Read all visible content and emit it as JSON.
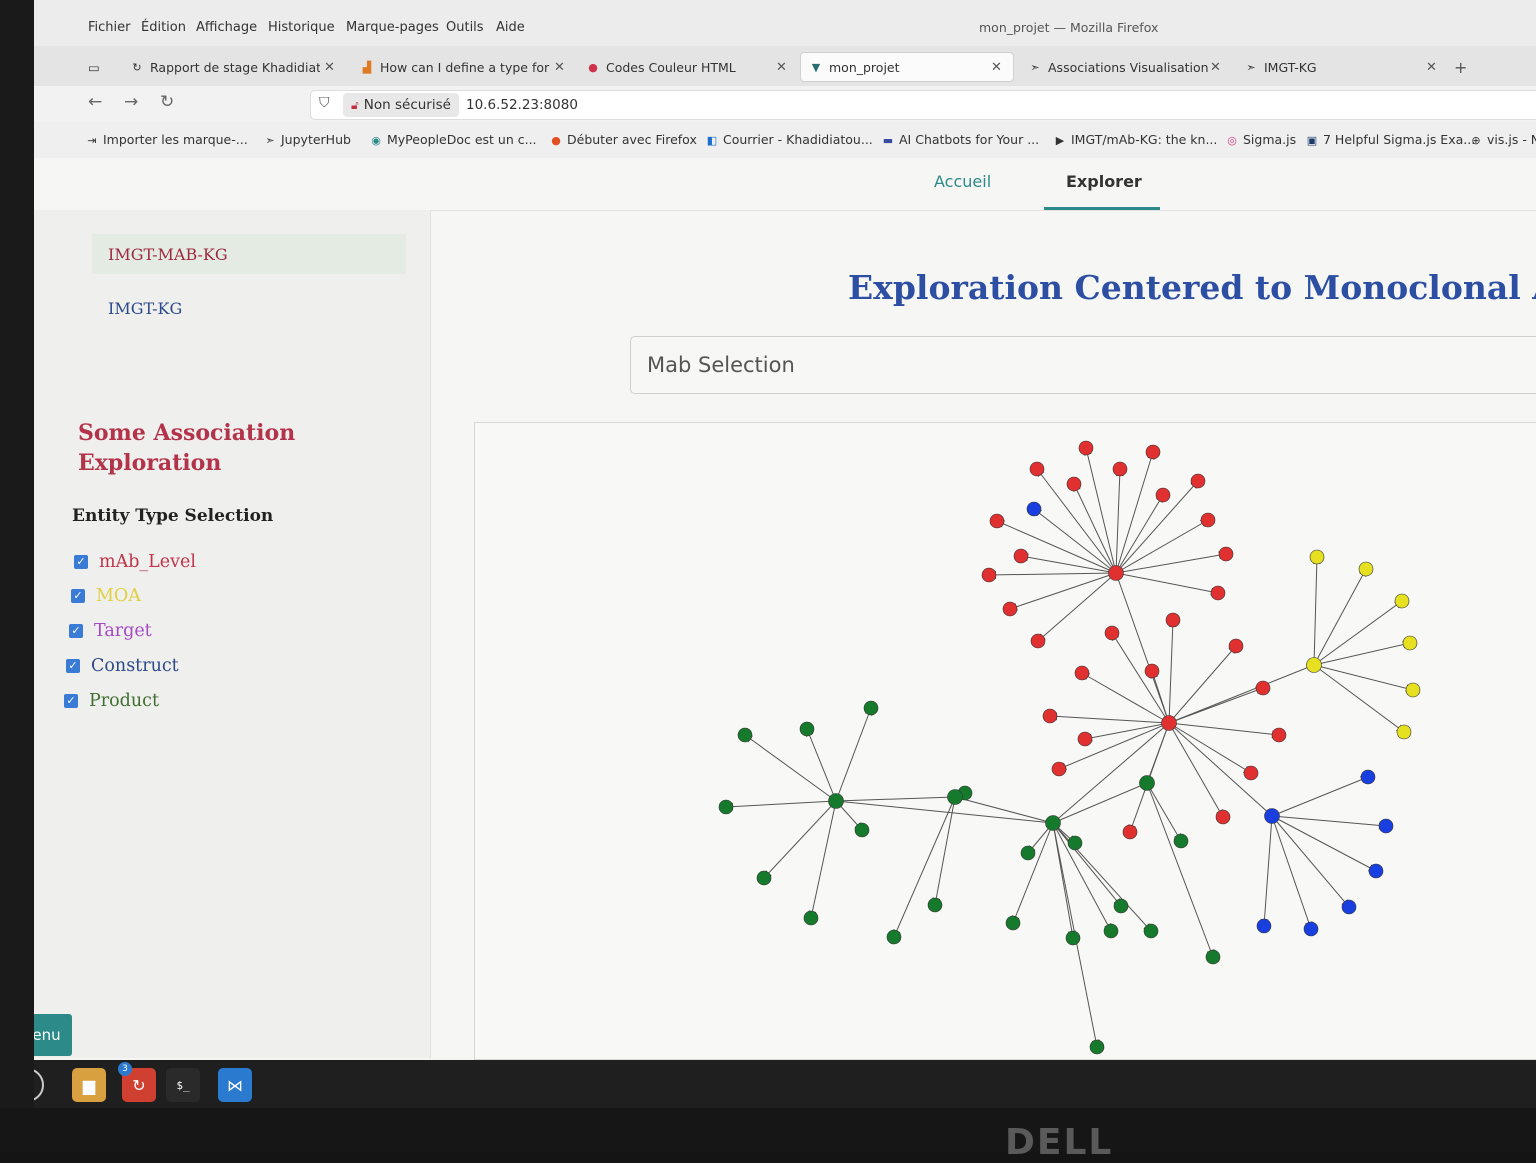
{
  "window_title": "mon_projet — Mozilla Firefox",
  "menu": [
    "Fichier",
    "Édition",
    "Affichage",
    "Historique",
    "Marque-pages",
    "Outils",
    "Aide"
  ],
  "tabs": [
    {
      "label": "Rapport de stage Khadidiato",
      "icon": "document-icon"
    },
    {
      "label": "How can I define a type for a",
      "icon": "stackoverflow-icon"
    },
    {
      "label": "Codes Couleur HTML",
      "icon": "color-icon"
    },
    {
      "label": "mon_projet",
      "icon": "vue-icon"
    },
    {
      "label": "Associations Visualisation",
      "icon": "jupyter-icon"
    },
    {
      "label": "IMGT-KG",
      "icon": "jupyter-icon"
    }
  ],
  "navbar": {
    "security_label": "Non sécurisé",
    "url": "10.6.52.23:8080"
  },
  "bookmarks": [
    {
      "label": "Importer les marque-...",
      "icon": "import-icon"
    },
    {
      "label": "JupyterHub",
      "icon": "jupyter-icon"
    },
    {
      "label": "MyPeopleDoc est un c...",
      "icon": "people-icon"
    },
    {
      "label": "Débuter avec Firefox",
      "icon": "firefox-icon"
    },
    {
      "label": "Courrier - Khadidiatou...",
      "icon": "outlook-icon"
    },
    {
      "label": "AI Chatbots for Your ...",
      "icon": "chatbot-icon"
    },
    {
      "label": "IMGT/mAb-KG: the kn...",
      "icon": "imgt-icon"
    },
    {
      "label": "Sigma.js",
      "icon": "sigma-icon"
    },
    {
      "label": "7 Helpful Sigma.js Exa...",
      "icon": "article-icon"
    },
    {
      "label": "vis.js - No",
      "icon": "globe-icon"
    }
  ],
  "top_nav": {
    "home": "Accueil",
    "explorer": "Explorer"
  },
  "sidebar": {
    "nav": [
      "IMGT-MAB-KG",
      "IMGT-KG"
    ],
    "section_title_line1": "Some Association",
    "section_title_line2": "Exploration",
    "entity_title": "Entity Type Selection",
    "checkboxes": [
      {
        "label": "mAb_Level",
        "color": "#c0344a",
        "checked": true
      },
      {
        "label": "MOA",
        "color": "#e0d040",
        "checked": true
      },
      {
        "label": "Target",
        "color": "#a448c4",
        "checked": true
      },
      {
        "label": "Construct",
        "color": "#2c4a8a",
        "checked": true
      },
      {
        "label": "Product",
        "color": "#3f6e30",
        "checked": true
      }
    ]
  },
  "main": {
    "title": "Exploration Centered to Monoclonal Antibo",
    "mab_select_placeholder": "Mab Selection"
  },
  "graph": {
    "colors": {
      "mab": "#e03030",
      "moa": "#e6e020",
      "construct": "#1a3fe0",
      "product": "#167a2c",
      "edge": "#555555"
    }
  },
  "menu_button": "Menu",
  "taskbar": {
    "firefox_badge": "3",
    "terminal_glyph": "$_"
  }
}
